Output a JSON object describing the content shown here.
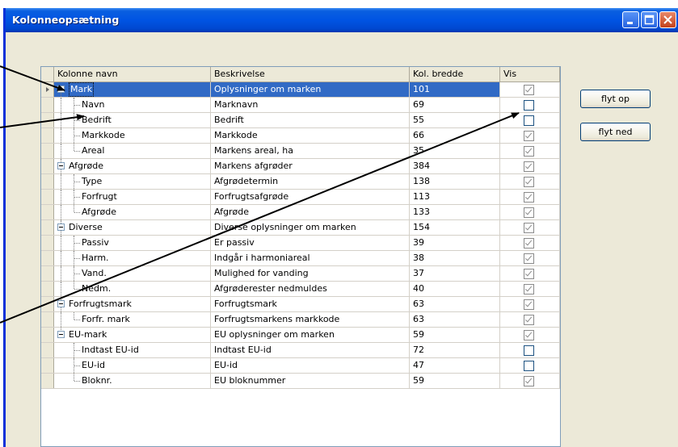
{
  "window": {
    "title": "Kolonneopsætning"
  },
  "grid": {
    "headers": [
      "Kolonne navn",
      "Beskrivelse",
      "Kol. bredde",
      "Vis"
    ],
    "rows": [
      {
        "name": "Mark",
        "desc": "Oplysninger om marken",
        "width": "101",
        "vis": true,
        "level": 0,
        "selected": true
      },
      {
        "name": "Navn",
        "desc": "Marknavn",
        "width": "69",
        "vis": false,
        "level": 1
      },
      {
        "name": "Bedrift",
        "desc": "Bedrift",
        "width": "55",
        "vis": false,
        "level": 1
      },
      {
        "name": "Markkode",
        "desc": "Markkode",
        "width": "66",
        "vis": true,
        "level": 1
      },
      {
        "name": "Areal",
        "desc": "Markens areal, ha",
        "width": "35",
        "vis": true,
        "level": 1,
        "last": true
      },
      {
        "name": "Afgrøde",
        "desc": "Markens afgrøder",
        "width": "384",
        "vis": true,
        "level": 0
      },
      {
        "name": "Type",
        "desc": "Afgrødetermin",
        "width": "138",
        "vis": true,
        "level": 1
      },
      {
        "name": "Forfrugt",
        "desc": "Forfrugtsafgrøde",
        "width": "113",
        "vis": true,
        "level": 1
      },
      {
        "name": "Afgrøde",
        "desc": "Afgrøde",
        "width": "133",
        "vis": true,
        "level": 1,
        "last": true
      },
      {
        "name": "Diverse",
        "desc": "Diverse oplysninger om marken",
        "width": "154",
        "vis": true,
        "level": 0
      },
      {
        "name": "Passiv",
        "desc": "Er passiv",
        "width": "39",
        "vis": true,
        "level": 1
      },
      {
        "name": "Harm.",
        "desc": "Indgår i harmoniareal",
        "width": "38",
        "vis": true,
        "level": 1
      },
      {
        "name": "Vand.",
        "desc": "Mulighed for vanding",
        "width": "37",
        "vis": true,
        "level": 1
      },
      {
        "name": "Nedm.",
        "desc": "Afgrøderester nedmuldes",
        "width": "40",
        "vis": true,
        "level": 1,
        "last": true
      },
      {
        "name": "Forfrugtsmark",
        "desc": "Forfrugtsmark",
        "width": "63",
        "vis": true,
        "level": 0
      },
      {
        "name": "Forfr. mark",
        "desc": "Forfrugtsmarkens markkode",
        "width": "63",
        "vis": true,
        "level": 1,
        "last": true
      },
      {
        "name": "EU-mark",
        "desc": "EU oplysninger om marken",
        "width": "59",
        "vis": true,
        "level": 0,
        "lastgroup": true
      },
      {
        "name": "Indtast EU-id",
        "desc": "Indtast EU-id",
        "width": "72",
        "vis": false,
        "level": 1
      },
      {
        "name": "EU-id",
        "desc": "EU-id",
        "width": "47",
        "vis": false,
        "level": 1
      },
      {
        "name": "Bloknr.",
        "desc": "EU bloknummer",
        "width": "59",
        "vis": true,
        "level": 1,
        "last": true
      }
    ]
  },
  "buttons": {
    "move_up": "flyt op",
    "move_down": "flyt ned"
  },
  "colors": {
    "titlebar": "#0054e3",
    "selection": "#316ac5",
    "face": "#ece9d8"
  }
}
